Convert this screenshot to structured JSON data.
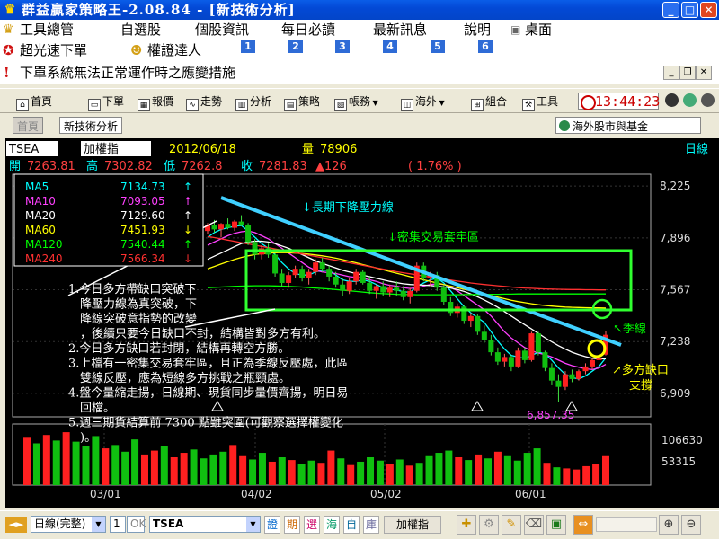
{
  "window": {
    "title": "群益贏家策略王-2.08.84 - [新技術分析]",
    "min": "_",
    "max": "□",
    "close": "✕"
  },
  "menu": [
    "工具總管",
    "自選股",
    "個股資訊",
    "每日必讀",
    "最新訊息",
    "說明",
    "桌面"
  ],
  "links": {
    "a": "超光速下單",
    "b": "權證達人",
    "nums": [
      "1",
      "2",
      "3",
      "4",
      "5",
      "6"
    ]
  },
  "notice": "下單系統無法正常運作時之應變措施",
  "toolbar": {
    "items": [
      "首頁",
      "下單",
      "報價",
      "走勢",
      "分析",
      "策略",
      "帳務",
      "海外",
      "組合",
      "工具"
    ],
    "clock": "13:44:23"
  },
  "tabs": {
    "home": "首頁",
    "analysis": "新技術分析",
    "overseas": "海外股市與基金"
  },
  "header": {
    "symbol": "TSEA",
    "name": "加權指",
    "date": "2012/06/18",
    "vol_label": "量",
    "vol": "78906",
    "period": "日線",
    "open_label": "開",
    "open": "7263.81",
    "high_label": "高",
    "high": "7302.82",
    "low_label": "低",
    "low": "7262.8",
    "close_label": "收",
    "close": "7281.83",
    "chg": "▲126",
    "pct": "( 1.76% )"
  },
  "ma": [
    {
      "name": "MA5",
      "value": "7134.73",
      "arrow": "↑",
      "color": "#00ffff"
    },
    {
      "name": "MA10",
      "value": "7093.05",
      "arrow": "↑",
      "color": "#ff40ff"
    },
    {
      "name": "MA20",
      "value": "7129.60",
      "arrow": "↑",
      "color": "#ffffff"
    },
    {
      "name": "MA60",
      "value": "7451.93",
      "arrow": "↓",
      "color": "#ffff00"
    },
    {
      "name": "MA120",
      "value": "7540.44",
      "arrow": "↑",
      "color": "#00ff00"
    },
    {
      "name": "MA240",
      "value": "7566.34",
      "arrow": "↓",
      "color": "#ff3030"
    }
  ],
  "annot": {
    "trend": "↓長期下降壓力線",
    "box": "↓密集交易套牢區",
    "season": "↖季線",
    "gap1": "↗多方缺口",
    "gap2": "支撐",
    "low": "6,857.35"
  },
  "notes": [
    "1.今日多方帶缺口突破下",
    "　降壓力線為真突破，下",
    "　降線突破意指勢的改變",
    "　，後續只要今日缺口不封，結構皆對多方有利。",
    "2.今日多方缺口若封閉，結構再轉空方勝。",
    "3.上檔有一密集交易套牢區，且正為季線反壓處，此區",
    "　雙線反壓，應為短線多方挑戰之瓶頸處。",
    "4.盤今量縮走揚，日線期、現貨同步量價齊揚，明日易",
    "　回檔。",
    "5.週三期貨結算前 7300 點雖突圍(可觀察選擇權變化",
    "　)。"
  ],
  "chart_data": {
    "type": "candlestick",
    "price_axis": {
      "ticks": [
        8225,
        7896,
        7567,
        7238,
        6909
      ],
      "range": [
        6760,
        8300
      ]
    },
    "volume_axis": {
      "ticks": [
        106630,
        53315
      ]
    },
    "x_labels": [
      "03/01",
      "04/02",
      "05/02",
      "06/01"
    ],
    "candles": [
      [
        7940,
        7990,
        7920,
        7975
      ],
      [
        7975,
        8010,
        7930,
        7950
      ],
      [
        7950,
        7990,
        7900,
        7985
      ],
      [
        7985,
        8020,
        7950,
        7960
      ],
      [
        7960,
        8010,
        7940,
        8000
      ],
      [
        8000,
        8040,
        7970,
        7980
      ],
      [
        7980,
        7990,
        7850,
        7870
      ],
      [
        7870,
        7890,
        7760,
        7790
      ],
      [
        7790,
        7850,
        7760,
        7830
      ],
      [
        7830,
        7860,
        7770,
        7790
      ],
      [
        7790,
        7800,
        7650,
        7670
      ],
      [
        7670,
        7700,
        7590,
        7610
      ],
      [
        7610,
        7680,
        7580,
        7660
      ],
      [
        7660,
        7720,
        7640,
        7700
      ],
      [
        7700,
        7720,
        7620,
        7640
      ],
      [
        7640,
        7700,
        7600,
        7680
      ],
      [
        7680,
        7760,
        7660,
        7740
      ],
      [
        7740,
        7770,
        7680,
        7700
      ],
      [
        7700,
        7720,
        7620,
        7650
      ],
      [
        7650,
        7680,
        7580,
        7600
      ],
      [
        7600,
        7640,
        7530,
        7560
      ],
      [
        7560,
        7640,
        7540,
        7620
      ],
      [
        7620,
        7700,
        7600,
        7680
      ],
      [
        7680,
        7690,
        7600,
        7610
      ],
      [
        7610,
        7650,
        7540,
        7560
      ],
      [
        7560,
        7600,
        7510,
        7590
      ],
      [
        7590,
        7620,
        7530,
        7550
      ],
      [
        7550,
        7600,
        7520,
        7580
      ],
      [
        7580,
        7620,
        7530,
        7560
      ],
      [
        7560,
        7590,
        7500,
        7520
      ],
      [
        7520,
        7580,
        7480,
        7560
      ],
      [
        7560,
        7740,
        7550,
        7720
      ],
      [
        7720,
        7740,
        7620,
        7640
      ],
      [
        7640,
        7680,
        7590,
        7660
      ],
      [
        7660,
        7680,
        7560,
        7580
      ],
      [
        7580,
        7600,
        7470,
        7490
      ],
      [
        7490,
        7520,
        7400,
        7420
      ],
      [
        7420,
        7480,
        7390,
        7460
      ],
      [
        7460,
        7470,
        7350,
        7370
      ],
      [
        7370,
        7420,
        7330,
        7400
      ],
      [
        7400,
        7410,
        7280,
        7300
      ],
      [
        7300,
        7340,
        7230,
        7250
      ],
      [
        7250,
        7280,
        7150,
        7170
      ],
      [
        7170,
        7200,
        7090,
        7110
      ],
      [
        7110,
        7160,
        7080,
        7140
      ],
      [
        7140,
        7150,
        7050,
        7080
      ],
      [
        7080,
        7200,
        7070,
        7180
      ],
      [
        7180,
        7200,
        7100,
        7120
      ],
      [
        7120,
        7300,
        7110,
        7290
      ],
      [
        7290,
        7300,
        7150,
        7170
      ],
      [
        7170,
        7180,
        7050,
        7070
      ],
      [
        7070,
        7100,
        6960,
        6990
      ],
      [
        6990,
        7030,
        6857,
        6950
      ],
      [
        6950,
        7050,
        6930,
        7030
      ],
      [
        7030,
        7060,
        6980,
        7000
      ],
      [
        7000,
        7060,
        6990,
        7050
      ],
      [
        7050,
        7100,
        7030,
        7080
      ],
      [
        7080,
        7130,
        7060,
        7120
      ],
      [
        7120,
        7160,
        7100,
        7130
      ],
      [
        7155,
        7302,
        7150,
        7281
      ]
    ],
    "volumes": [
      0.85,
      0.75,
      0.9,
      0.8,
      0.95,
      0.78,
      0.7,
      0.88,
      0.66,
      0.72,
      0.6,
      0.82,
      0.55,
      0.62,
      0.7,
      0.5,
      0.58,
      0.64,
      0.48,
      0.55,
      0.6,
      0.72,
      0.52,
      0.46,
      0.58,
      0.42,
      0.5,
      0.45,
      0.38,
      0.44,
      0.4,
      0.62,
      0.48,
      0.36,
      0.42,
      0.5,
      0.44,
      0.38,
      0.46,
      0.35,
      0.4,
      0.52,
      0.58,
      0.62,
      0.5,
      0.45,
      0.55,
      0.48,
      0.6,
      0.52,
      0.44,
      0.58,
      0.66,
      0.4,
      0.32,
      0.3,
      0.28,
      0.34,
      0.38,
      0.52
    ],
    "series": {
      "MA5": [
        7900,
        7930,
        7950,
        7960,
        7970,
        7975,
        7940,
        7900,
        7860,
        7830,
        7790,
        7740,
        7700,
        7670,
        7660,
        7660,
        7680,
        7690,
        7690,
        7660,
        7630,
        7620,
        7620,
        7630,
        7620,
        7600,
        7580,
        7570,
        7565,
        7555,
        7550,
        7590,
        7610,
        7630,
        7640,
        7610,
        7560,
        7510,
        7460,
        7420,
        7390,
        7360,
        7300,
        7240,
        7190,
        7150,
        7140,
        7130,
        7150,
        7170,
        7160,
        7120,
        7070,
        7030,
        7010,
        7000,
        7020,
        7050,
        7080,
        7134
      ],
      "MA10": [
        7850,
        7870,
        7890,
        7910,
        7925,
        7935,
        7940,
        7930,
        7910,
        7890,
        7860,
        7830,
        7800,
        7770,
        7740,
        7710,
        7690,
        7680,
        7675,
        7670,
        7660,
        7650,
        7645,
        7640,
        7630,
        7620,
        7605,
        7595,
        7590,
        7580,
        7575,
        7580,
        7590,
        7600,
        7605,
        7600,
        7585,
        7560,
        7530,
        7500,
        7470,
        7440,
        7400,
        7350,
        7300,
        7260,
        7230,
        7200,
        7180,
        7165,
        7155,
        7140,
        7120,
        7100,
        7085,
        7075,
        7065,
        7060,
        7070,
        7093
      ],
      "MA20": [
        7760,
        7780,
        7800,
        7820,
        7840,
        7860,
        7870,
        7875,
        7875,
        7870,
        7860,
        7845,
        7830,
        7810,
        7790,
        7770,
        7750,
        7735,
        7720,
        7705,
        7690,
        7680,
        7670,
        7660,
        7650,
        7640,
        7630,
        7620,
        7612,
        7605,
        7600,
        7598,
        7596,
        7594,
        7590,
        7585,
        7578,
        7568,
        7556,
        7540,
        7522,
        7502,
        7480,
        7455,
        7428,
        7400,
        7372,
        7345,
        7318,
        7290,
        7262,
        7236,
        7212,
        7190,
        7170,
        7155,
        7142,
        7132,
        7128,
        7129
      ],
      "MA60": [
        7700,
        7715,
        7730,
        7745,
        7760,
        7772,
        7782,
        7790,
        7796,
        7800,
        7802,
        7803,
        7802,
        7800,
        7797,
        7793,
        7788,
        7782,
        7775,
        7767,
        7758,
        7748,
        7738,
        7727,
        7716,
        7705,
        7694,
        7683,
        7672,
        7661,
        7650,
        7640,
        7630,
        7620,
        7610,
        7600,
        7590,
        7580,
        7570,
        7560,
        7550,
        7540,
        7530,
        7520,
        7510,
        7500,
        7492,
        7485,
        7478,
        7472,
        7467,
        7463,
        7460,
        7457,
        7455,
        7454,
        7453,
        7452,
        7452,
        7451
      ],
      "MA120": [
        7580,
        7582,
        7584,
        7586,
        7588,
        7590,
        7591,
        7592,
        7592,
        7592,
        7591,
        7590,
        7588,
        7586,
        7584,
        7581,
        7578,
        7575,
        7572,
        7568,
        7564,
        7560,
        7556,
        7552,
        7548,
        7545,
        7542,
        7540,
        7538,
        7537,
        7536,
        7535,
        7535,
        7535,
        7535,
        7535,
        7535,
        7535,
        7536,
        7536,
        7537,
        7537,
        7538,
        7538,
        7539,
        7539,
        7540,
        7540,
        7540,
        7540,
        7540,
        7540,
        7540,
        7540,
        7540,
        7540,
        7540,
        7540,
        7540,
        7540
      ],
      "MA240": [
        7905,
        7898,
        7890,
        7882,
        7874,
        7866,
        7858,
        7850,
        7842,
        7834,
        7826,
        7818,
        7810,
        7802,
        7794,
        7786,
        7778,
        7770,
        7762,
        7754,
        7746,
        7738,
        7730,
        7722,
        7714,
        7706,
        7698,
        7690,
        7682,
        7675,
        7668,
        7661,
        7654,
        7647,
        7640,
        7634,
        7628,
        7622,
        7616,
        7610,
        7605,
        7600,
        7596,
        7592,
        7588,
        7584,
        7581,
        7578,
        7576,
        7574,
        7572,
        7571,
        7570,
        7569,
        7568,
        7568,
        7567,
        7567,
        7566,
        7566
      ]
    }
  },
  "bottom": {
    "period_select": "日線(完整)",
    "num": "1",
    "ok": "OK",
    "symbol": "TSEA",
    "btns": [
      "證",
      "期",
      "選",
      "海",
      "自",
      "庫"
    ],
    "name_btn": "加權指"
  }
}
